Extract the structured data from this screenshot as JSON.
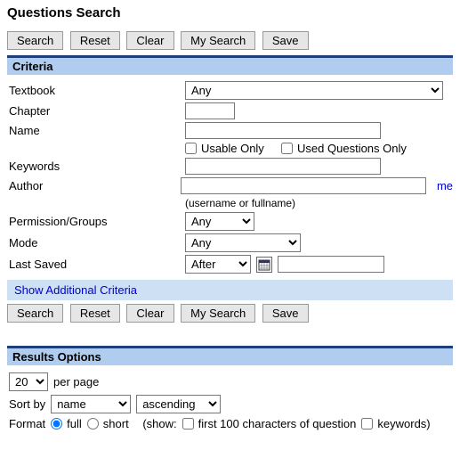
{
  "page_title": "Questions Search",
  "toolbar": {
    "search": "Search",
    "reset": "Reset",
    "clear": "Clear",
    "my_search": "My Search",
    "save": "Save"
  },
  "criteria": {
    "header": "Criteria",
    "textbook_label": "Textbook",
    "textbook_value": "Any",
    "chapter_label": "Chapter",
    "chapter_value": "",
    "name_label": "Name",
    "name_value": "",
    "usable_only_label": "Usable Only",
    "used_only_label": "Used Questions Only",
    "keywords_label": "Keywords",
    "keywords_value": "",
    "author_label": "Author",
    "author_value": "",
    "author_hint": "(username or fullname)",
    "me_label": "me",
    "permission_label": "Permission/Groups",
    "permission_value": "Any",
    "mode_label": "Mode",
    "mode_value": "Any",
    "last_saved_label": "Last Saved",
    "last_saved_op": "After",
    "last_saved_value": "",
    "show_additional": "Show Additional Criteria"
  },
  "results": {
    "header": "Results Options",
    "per_page_value": "20",
    "per_page_label": "per page",
    "sort_by_label": "Sort by",
    "sort_by_value": "name",
    "sort_dir_value": "ascending",
    "format_label": "Format",
    "format_full": "full",
    "format_short": "short",
    "show_label": "(show:",
    "first100_label": "first 100 characters of question",
    "keywords_label": "keywords)"
  }
}
